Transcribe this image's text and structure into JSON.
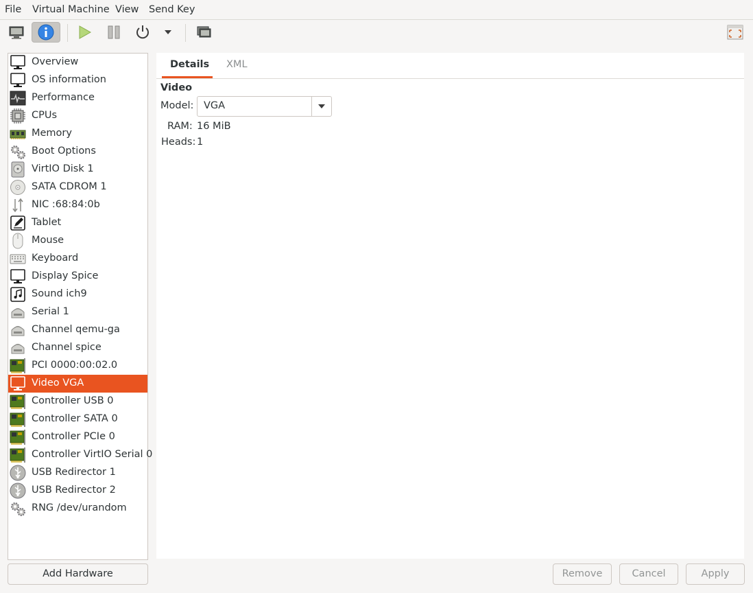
{
  "menu": [
    "File",
    "Virtual Machine",
    "View",
    "Send Key"
  ],
  "toolbar": {
    "items": [
      "console-icon",
      "details-icon",
      "run-icon",
      "pause-icon",
      "shutdown-icon",
      "shutdown-menu-icon",
      "snapshots-icon",
      "fullscreen-icon"
    ]
  },
  "sidebar": {
    "items": [
      {
        "label": "Overview",
        "icon": "monitor-icon"
      },
      {
        "label": "OS information",
        "icon": "monitor-icon"
      },
      {
        "label": "Performance",
        "icon": "performance-icon"
      },
      {
        "label": "CPUs",
        "icon": "cpu-icon"
      },
      {
        "label": "Memory",
        "icon": "memory-icon"
      },
      {
        "label": "Boot Options",
        "icon": "gears-icon"
      },
      {
        "label": "VirtIO Disk 1",
        "icon": "disk-icon"
      },
      {
        "label": "SATA CDROM 1",
        "icon": "cdrom-icon"
      },
      {
        "label": "NIC :68:84:0b",
        "icon": "network-icon"
      },
      {
        "label": "Tablet",
        "icon": "tablet-icon"
      },
      {
        "label": "Mouse",
        "icon": "mouse-icon"
      },
      {
        "label": "Keyboard",
        "icon": "keyboard-icon"
      },
      {
        "label": "Display Spice",
        "icon": "monitor-icon"
      },
      {
        "label": "Sound ich9",
        "icon": "sound-icon"
      },
      {
        "label": "Serial 1",
        "icon": "serial-icon"
      },
      {
        "label": "Channel qemu-ga",
        "icon": "serial-icon"
      },
      {
        "label": "Channel spice",
        "icon": "serial-icon"
      },
      {
        "label": "PCI 0000:00:02.0",
        "icon": "pci-card-icon"
      },
      {
        "label": "Video VGA",
        "icon": "monitor-icon",
        "selected": true
      },
      {
        "label": "Controller USB 0",
        "icon": "pci-card-icon"
      },
      {
        "label": "Controller SATA 0",
        "icon": "pci-card-icon"
      },
      {
        "label": "Controller PCIe 0",
        "icon": "pci-card-icon"
      },
      {
        "label": "Controller VirtIO Serial 0",
        "icon": "pci-card-icon"
      },
      {
        "label": "USB Redirector 1",
        "icon": "usb-icon"
      },
      {
        "label": "USB Redirector 2",
        "icon": "usb-icon"
      },
      {
        "label": "RNG /dev/urandom",
        "icon": "gears-icon"
      }
    ],
    "add_label": "Add Hardware"
  },
  "tabs": {
    "details": "Details",
    "xml": "XML"
  },
  "video": {
    "section": "Video",
    "model_label": "Model:",
    "model_value": "VGA",
    "ram_label": "RAM:",
    "ram_value": "16 MiB",
    "heads_label": "Heads:",
    "heads_value": "1"
  },
  "actions": {
    "remove": "Remove",
    "cancel": "Cancel",
    "apply": "Apply"
  },
  "colors": {
    "accent": "#e95420",
    "sidebar_bg": "#ffffff",
    "window_bg": "#f6f5f4"
  }
}
